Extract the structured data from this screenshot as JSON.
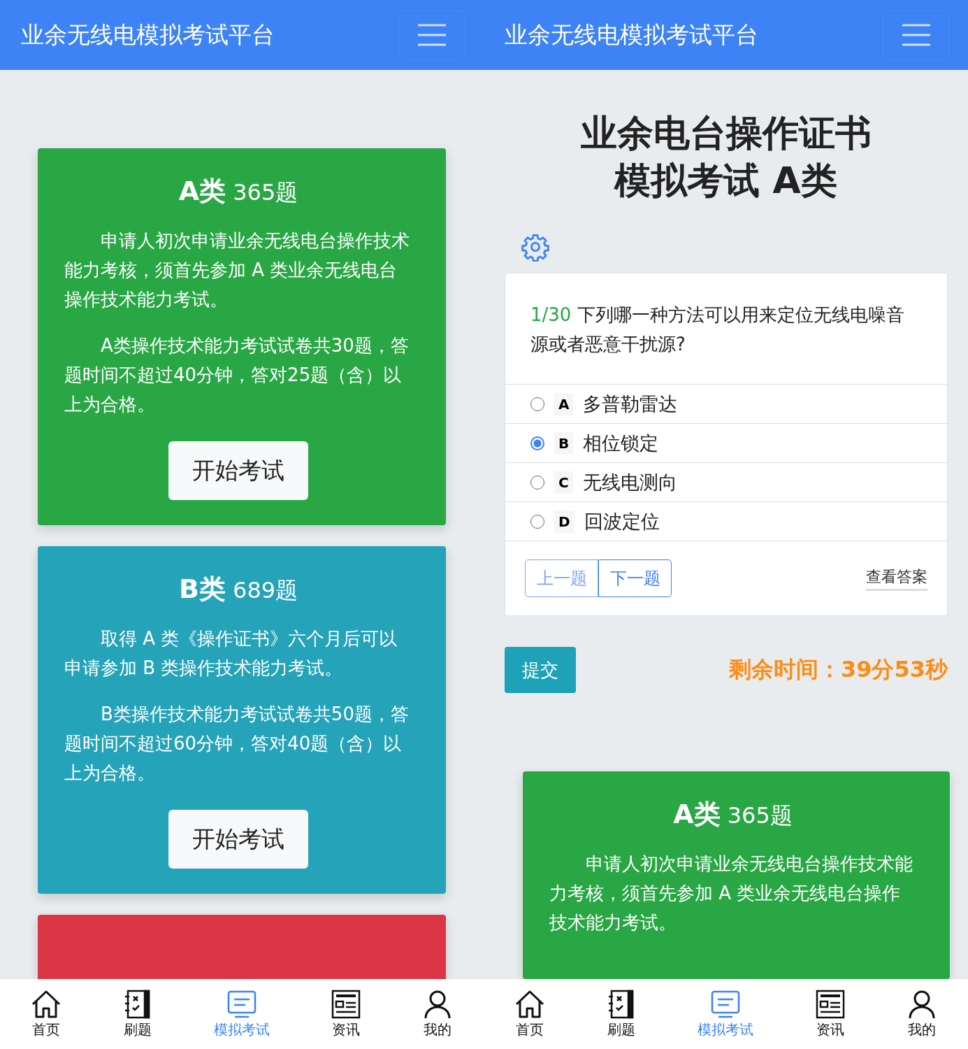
{
  "phones": [
    {
      "kind": "home",
      "header": {
        "title": "业余无线电模拟考试平台"
      },
      "cards": [
        {
          "title": "A类",
          "count": "365题",
          "color": "#29a745",
          "paragraphs": [
            "申请人初次申请业余无线电台操作技术能力考核，须首先参加 A 类业余无线电台操作技术能力考试。",
            "A类操作技术能力考试试卷共30题，答题时间不超过40分钟，答对25题（含）以上为合格。"
          ],
          "button": "开始考试"
        },
        {
          "title": "B类",
          "count": "689题",
          "color": "#25a3b8",
          "paragraphs": [
            "取得 A 类《操作证书》六个月后可以申请参加 B 类操作技术能力考试。",
            "B类操作技术能力考试试卷共50题，答题时间不超过60分钟，答对40题（含）以上为合格。"
          ],
          "button": "开始考试"
        },
        {
          "color": "#dc3545"
        }
      ],
      "nav": [
        {
          "label": "首页",
          "kind": "home",
          "selected": false
        },
        {
          "label": "刷题",
          "kind": "notebook",
          "selected": false
        },
        {
          "label": "模拟考试",
          "kind": "exam",
          "selected": true
        },
        {
          "label": "资讯",
          "kind": "news",
          "selected": false
        },
        {
          "label": "我的",
          "kind": "user",
          "selected": false
        }
      ]
    },
    {
      "kind": "exam",
      "header": {
        "title": "业余无线电模拟考试平台"
      },
      "exam_title": [
        "业余电台操作证书",
        "模拟考试 A类"
      ],
      "question": {
        "number": "1/30",
        "text": "下列哪一种方法可以用来定位无线电噪音源或者恶意干扰源?",
        "options": [
          {
            "letter": "A",
            "text": "多普勒雷达",
            "selected": false
          },
          {
            "letter": "B",
            "text": "相位锁定",
            "selected": true
          },
          {
            "letter": "C",
            "text": "无线电测向",
            "selected": false
          },
          {
            "letter": "D",
            "text": "回波定位",
            "selected": false
          }
        ],
        "prev": "上一题",
        "next": "下一题",
        "answer_link": "查看答案"
      },
      "submit": "提交",
      "timer": "剩余时间：39分53秒",
      "cards": [
        {
          "title": "A类",
          "count": "365题",
          "color": "#29a745",
          "paragraphs": [
            "申请人初次申请业余无线电台操作技术能力考核，须首先参加 A 类业余无线电台操作技术能力考试。"
          ]
        }
      ],
      "nav": [
        {
          "label": "首页",
          "kind": "home",
          "selected": false
        },
        {
          "label": "刷题",
          "kind": "notebook",
          "selected": false
        },
        {
          "label": "模拟考试",
          "kind": "exam",
          "selected": true
        },
        {
          "label": "资讯",
          "kind": "news",
          "selected": false
        },
        {
          "label": "我的",
          "kind": "user",
          "selected": false
        }
      ]
    }
  ]
}
